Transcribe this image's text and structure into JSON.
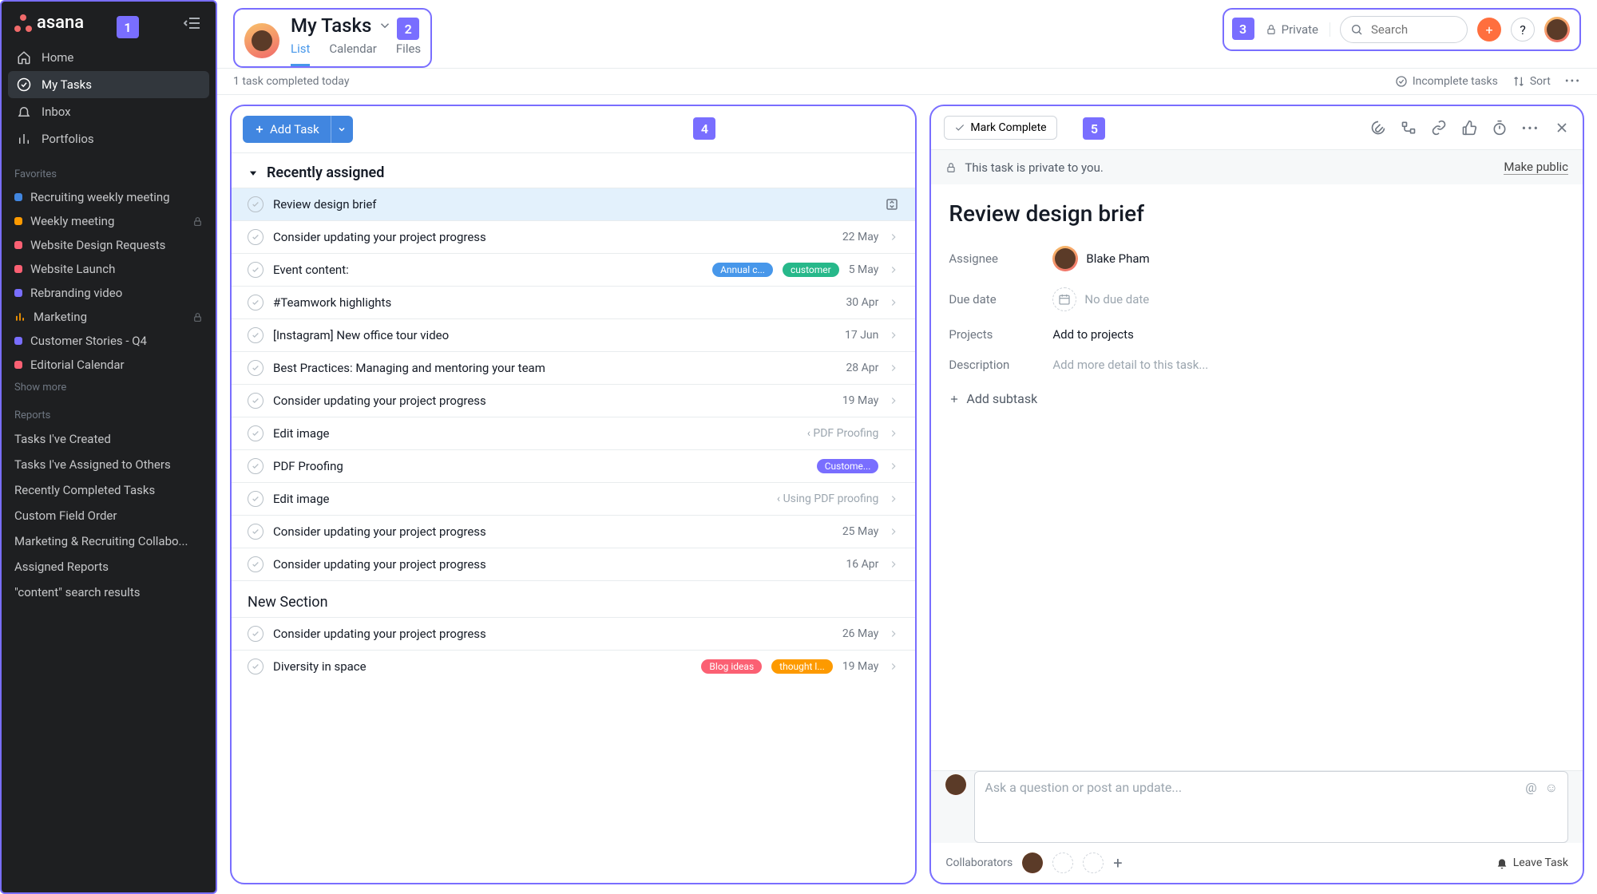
{
  "badges": {
    "b1": "1",
    "b2": "2",
    "b3": "3",
    "b4": "4",
    "b5": "5"
  },
  "brand": "asana",
  "nav": [
    {
      "label": "Home"
    },
    {
      "label": "My Tasks",
      "active": true
    },
    {
      "label": "Inbox"
    },
    {
      "label": "Portfolios"
    }
  ],
  "favorites_label": "Favorites",
  "favorites": [
    {
      "label": "Recruiting weekly meeting",
      "color": "#4186e0"
    },
    {
      "label": "Weekly meeting",
      "color": "#fd9a00",
      "locked": true
    },
    {
      "label": "Website Design Requests",
      "color": "#fb6073"
    },
    {
      "label": "Website Launch",
      "color": "#fb6073"
    },
    {
      "label": "Rebranding video",
      "color": "#796eff"
    },
    {
      "label": "Marketing",
      "color": "#fd9a00",
      "chart": true,
      "locked": true
    },
    {
      "label": "Customer Stories - Q4",
      "color": "#796eff"
    },
    {
      "label": "Editorial Calendar",
      "color": "#fb6073"
    }
  ],
  "show_more": "Show more",
  "reports_label": "Reports",
  "reports": [
    "Tasks I've Created",
    "Tasks I've Assigned to Others",
    "Recently Completed Tasks",
    "Custom Field Order",
    "Marketing & Recruiting Collabo...",
    "Assigned Reports",
    "\"content\" search results"
  ],
  "header": {
    "title": "My Tasks",
    "tabs": [
      "List",
      "Calendar",
      "Files"
    ],
    "private": "Private",
    "search_placeholder": "Search"
  },
  "subheader": {
    "status": "1 task completed today",
    "filter": "Incomplete tasks",
    "sort": "Sort"
  },
  "tasks": {
    "add": "Add Task",
    "section1": "Recently assigned",
    "section2": "New Section",
    "rows": [
      {
        "title": "Review design brief",
        "selected": true,
        "move": true
      },
      {
        "title": "Consider updating your project progress",
        "date": "22 May"
      },
      {
        "title": "Event content:",
        "tags": [
          {
            "text": "Annual c...",
            "bg": "#4797ea"
          },
          {
            "text": "customer",
            "bg": "#27b88a"
          }
        ],
        "date": "5 May"
      },
      {
        "title": "#Teamwork highlights",
        "date": "30 Apr"
      },
      {
        "title": "[Instagram] New office tour video",
        "date": "17 Jun"
      },
      {
        "title": "Best Practices: Managing and mentoring your team",
        "date": "28 Apr"
      },
      {
        "title": "Consider updating your project progress",
        "date": "19 May"
      },
      {
        "title": "Edit image",
        "parent": "‹ PDF Proofing"
      },
      {
        "title": "PDF Proofing",
        "tags": [
          {
            "text": "Custome...",
            "bg": "#796eff"
          }
        ]
      },
      {
        "title": "Edit image",
        "parent": "‹ Using PDF proofing"
      },
      {
        "title": "Consider updating your project progress",
        "date": "25 May"
      },
      {
        "title": "Consider updating your project progress",
        "date": "16 Apr"
      }
    ],
    "rows2": [
      {
        "title": "Consider updating your project progress",
        "date": "26 May"
      },
      {
        "title": "Diversity in space",
        "tags": [
          {
            "text": "Blog ideas",
            "bg": "#fb6073"
          },
          {
            "text": "thought l...",
            "bg": "#fd9a00"
          }
        ],
        "date": "19 May"
      }
    ]
  },
  "detail": {
    "mark": "Mark Complete",
    "priv_msg": "This task is private to you.",
    "make_public": "Make public",
    "title": "Review design brief",
    "assignee_label": "Assignee",
    "assignee_name": "Blake Pham",
    "due_label": "Due date",
    "due_val": "No due date",
    "projects_label": "Projects",
    "projects_val": "Add to projects",
    "desc_label": "Description",
    "desc_val": "Add more detail to this task...",
    "add_subtask": "Add subtask",
    "comment_placeholder": "Ask a question or post an update...",
    "collab": "Collaborators",
    "leave": "Leave Task"
  }
}
